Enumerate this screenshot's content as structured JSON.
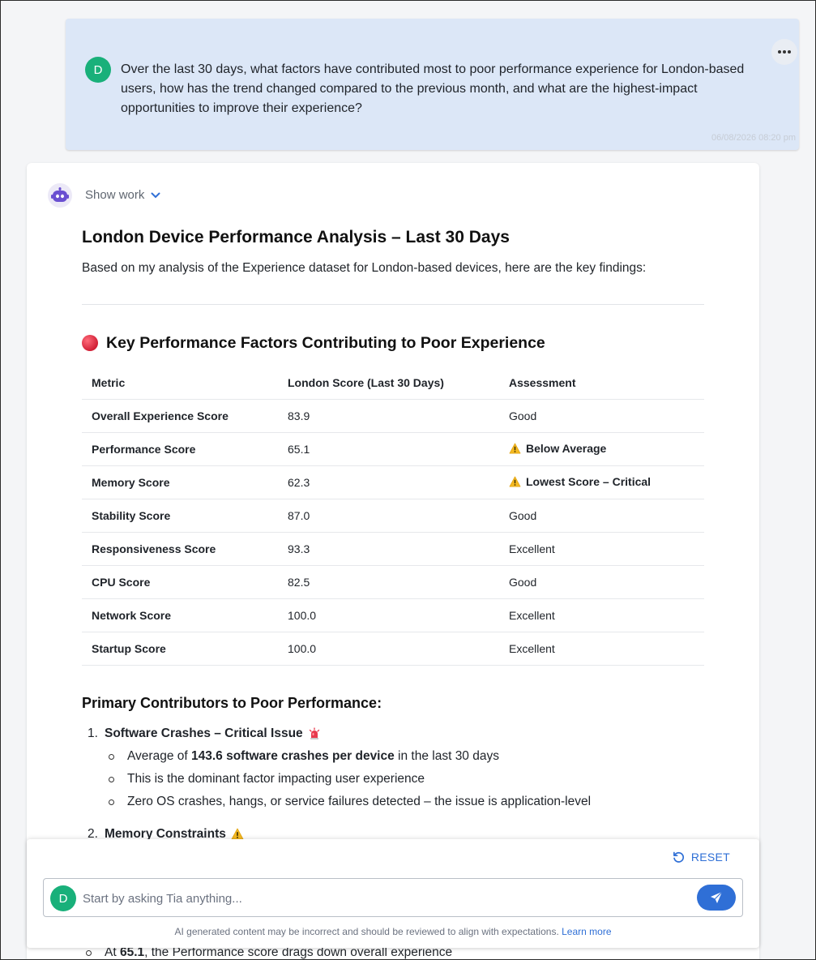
{
  "user_message": {
    "avatar_letter": "D",
    "text": "Over the last 30 days, what factors have contributed most to poor performance experience for London-based users, how has the trend changed compared to the previous month, and what are the highest-impact opportunities to improve their experience?",
    "timestamp": "06/08/2026 08:20 pm",
    "more_icon": "more-horizontal-icon"
  },
  "assistant": {
    "bot_icon": "robot-icon",
    "show_work_label": "Show work",
    "title": "London Device Performance Analysis – Last 30 Days",
    "intro": "Based on my analysis of the Experience dataset for London-based devices, here are the key findings:",
    "section_heading": "Key Performance Factors Contributing to Poor Experience",
    "table": {
      "headers": [
        "Metric",
        "London Score (Last 30 Days)",
        "Assessment"
      ],
      "rows": [
        {
          "metric": "Overall Experience Score",
          "score": "83.9",
          "assessment": "Good",
          "warn": false
        },
        {
          "metric": "Performance Score",
          "score": "65.1",
          "assessment": "Below Average",
          "warn": true
        },
        {
          "metric": "Memory Score",
          "score": "62.3",
          "assessment": "Lowest Score – Critical",
          "warn": true
        },
        {
          "metric": "Stability Score",
          "score": "87.0",
          "assessment": "Good",
          "warn": false
        },
        {
          "metric": "Responsiveness Score",
          "score": "93.3",
          "assessment": "Excellent",
          "warn": false
        },
        {
          "metric": "CPU Score",
          "score": "82.5",
          "assessment": "Good",
          "warn": false
        },
        {
          "metric": "Network Score",
          "score": "100.0",
          "assessment": "Excellent",
          "warn": false
        },
        {
          "metric": "Startup Score",
          "score": "100.0",
          "assessment": "Excellent",
          "warn": false
        }
      ]
    },
    "contributors_heading": "Primary Contributors to Poor Performance:",
    "contributors": {
      "item1": {
        "num": "1.",
        "title": "Software Crashes – Critical Issue",
        "icon": "siren-icon",
        "b1_pre": "Average of ",
        "b1_bold": "143.6 software crashes per device",
        "b1_post": " in the last 30 days",
        "b2": "This is the dominant factor impacting user experience",
        "b3": "Zero OS crashes, hangs, or service failures detected – the issue is application-level"
      },
      "item2": {
        "num": "2.",
        "title": "Memory Constraints",
        "icon": "warning-icon"
      }
    },
    "peek_pre": "At ",
    "peek_bold": "65.1",
    "peek_post": ", the Performance score drags down overall experience"
  },
  "composer": {
    "reset_label": "RESET",
    "avatar_letter": "D",
    "placeholder": "Start by asking Tia anything...",
    "disclaimer": "AI generated content may be incorrect and should be reviewed to align with expectations.",
    "learn_more": "Learn more"
  }
}
